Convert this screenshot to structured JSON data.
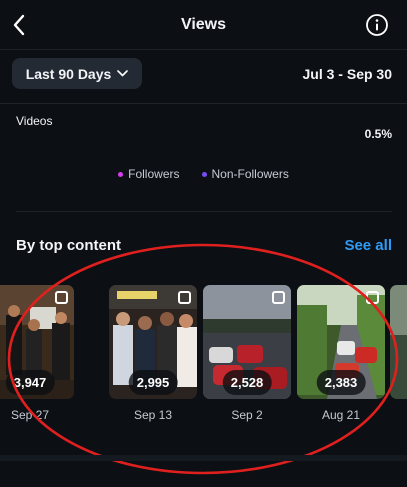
{
  "header": {
    "title": "Views",
    "back_icon": "chevron-left-icon",
    "info_icon": "info-icon"
  },
  "filter": {
    "label": "Last 90 Days",
    "date_range": "Jul 3 - Sep 30"
  },
  "breakdown": {
    "label": "Videos",
    "value": "0.5%",
    "legend": [
      {
        "label": "Followers",
        "color": "#d63cf0"
      },
      {
        "label": "Non-Followers",
        "color": "#7a4cf5"
      }
    ]
  },
  "top_content": {
    "title": "By top content",
    "see_all": "See all",
    "items": [
      {
        "views": "3,947",
        "date": "Sep 27"
      },
      {
        "views": "2,995",
        "date": "Sep 13"
      },
      {
        "views": "2,528",
        "date": "Sep 2"
      },
      {
        "views": "2,383",
        "date": "Aug 21"
      }
    ]
  },
  "colors": {
    "background": "#0c0f14",
    "accent": "#2f9bf5",
    "highlight": "#e0201e"
  }
}
